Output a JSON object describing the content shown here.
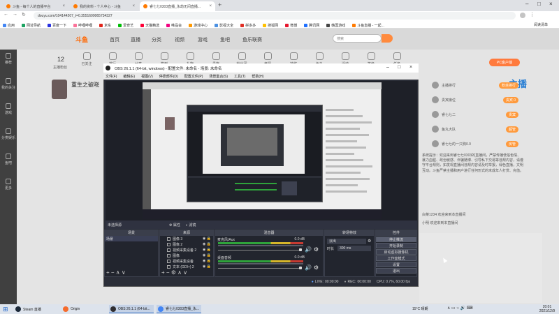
{
  "browser": {
    "tabs": [
      {
        "label": "斗鱼 - 每个人的直播平台",
        "color": "#ff7a00"
      },
      {
        "label": "我的资料 - 个人中心 - 斗鱼",
        "color": "#ff7a00"
      },
      {
        "label": "睿七七0303直播_永劫无间直播...",
        "color": "#ff7a00"
      }
    ],
    "new_tab": "+",
    "url": "douyu.com/104144207_t=0.3551609065734327",
    "bookmarks": [
      {
        "label": "应用",
        "color": "#4285f4"
      },
      {
        "label": "网址导航",
        "color": "#1aa260"
      },
      {
        "label": "百度一下",
        "color": "#2932e1"
      },
      {
        "label": "哔哩哔哩",
        "color": "#fb7299"
      },
      {
        "label": "京东",
        "color": "#e1251b"
      },
      {
        "label": "爱奇艺",
        "color": "#00be06"
      },
      {
        "label": "天猫精选",
        "color": "#ff0036"
      },
      {
        "label": "唯品会",
        "color": "#f10180"
      },
      {
        "label": "游戏中心",
        "color": "#ff9900"
      },
      {
        "label": "影视大全",
        "color": "#4a90e2"
      },
      {
        "label": "拼多多",
        "color": "#e02e24"
      },
      {
        "label": "搜狐网",
        "color": "#ffc000"
      },
      {
        "label": "微博",
        "color": "#e6162d"
      },
      {
        "label": "腾讯网",
        "color": "#1e6fff"
      },
      {
        "label": "韩国游戏",
        "color": "#444444"
      },
      {
        "label": "斗鱼直播 - 一起...",
        "color": "#ff7a00"
      }
    ],
    "reading_list": "阅读清单"
  },
  "douyu": {
    "logo": "斗鱼",
    "nav": [
      "首页",
      "直播",
      "分类",
      "视频",
      "游戏",
      "鱼吧",
      "鱼乐联赛"
    ],
    "search_placeholder": "搜索",
    "sidebar": [
      "推荐",
      "我的关注",
      "游戏",
      "分类娱乐",
      "鱼吧",
      "更多"
    ],
    "anchor_stats": {
      "count": "12",
      "label": "主播粉丝"
    },
    "anchor_icons": [
      "已关注",
      "排行",
      "分享",
      "签到",
      "礼物",
      "贵族",
      "粉丝团",
      "竞猜",
      "抽奖",
      "鱼丸",
      "活动",
      "等级",
      "任务"
    ],
    "streamer_name": "重生之破晓",
    "pc_button": "PC客户端",
    "promo": "主播",
    "right_rows": [
      {
        "label": "主播排行",
        "badge": "粉丝排行"
      },
      {
        "label": "贵宾席位",
        "badge": "贵宾 0"
      },
      {
        "label": "睿七七二",
        "badge": "贵宾"
      },
      {
        "label": "鱼丸大队",
        "badge": "超管"
      },
      {
        "label": "睿七七的一只狗0.0",
        "badge": "房管"
      }
    ],
    "chat_notice": "系统提示：欢迎来到睿七七0303的直播间，严禁传播低俗色情、暴力血腥、政治敏感、诈骗赌博、引导私下交易等违规内容，请遵守平台规则，如发现直播间违规内容请及时举报，绿色直播，文明互动。斗鱼严禁主播和用户进行任何形式的未成年人打赏、充值。",
    "chat_lines": [
      "白菜1234 欢迎来到本直播间",
      "小明 欢迎来到本直播间"
    ]
  },
  "obs": {
    "title": "OBS 26.1.1 (64-bit, windows) - 配置文件: 未命名 - 场景: 未命名",
    "menu": [
      "文件(F)",
      "编辑(E)",
      "视图(V)",
      "停靠部件(D)",
      "配置文件(P)",
      "场景集合(S)",
      "工具(T)",
      "帮助(H)"
    ],
    "source_bar": {
      "label": "未选择源",
      "props": "属性",
      "filters": "滤镜"
    },
    "docks": {
      "scenes": {
        "title": "场景",
        "items": [
          "场景"
        ]
      },
      "sources": {
        "title": "来源",
        "items": [
          "图像 3",
          "图像 2",
          "视频采集设备 2",
          "图像",
          "视频采集设备",
          "文本 (GDI+) 2"
        ]
      },
      "mixer": {
        "title": "混音器",
        "channels": [
          {
            "name": "麦克风/Aux",
            "db": "0.0 dB"
          },
          {
            "name": "桌面音频",
            "db": "0.0 dB"
          }
        ]
      },
      "transitions": {
        "title": "转场特效",
        "type": "淡出",
        "duration_label": "时长",
        "duration": "300 ms"
      },
      "controls": {
        "title": "控件",
        "buttons": [
          "停止推流",
          "开始录制",
          "启动虚拟摄像机",
          "工作室模式",
          "设置",
          "退出"
        ]
      }
    },
    "status": {
      "live_label": "LIVE:",
      "live": "00:00:00",
      "rec_label": "REC:",
      "rec": "00:00:00",
      "cpu": "CPU: 0.7%, 60.00 fps"
    }
  },
  "taskbar": {
    "items": [
      {
        "label": "Steam 直播",
        "color": "#1b2838"
      },
      {
        "label": "Origin",
        "color": "#f56c2d"
      },
      {
        "label": "OBS 26.1.1 (64-bit...",
        "color": "#302e31"
      },
      {
        "label": "睿七七0303直播_永...",
        "color": "#4285f4"
      }
    ],
    "weather": "15°C 晴朗",
    "time": "20:01",
    "date": "2021/12/9"
  }
}
